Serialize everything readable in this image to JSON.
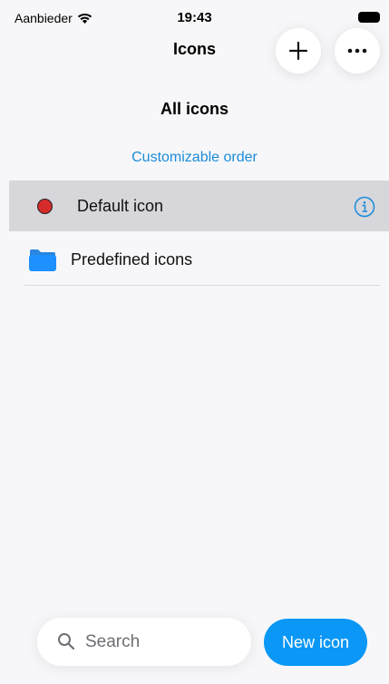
{
  "status": {
    "carrier": "Aanbieder",
    "time": "19:43"
  },
  "nav": {
    "title": "Icons",
    "add_icon": "plus-icon",
    "more_icon": "ellipsis-icon"
  },
  "list": {
    "section_title": "All icons",
    "order_link": "Customizable order",
    "items": [
      {
        "label": "Default icon",
        "icon": "red-dot-icon",
        "selected": true,
        "accessory": "info-icon"
      },
      {
        "label": "Predefined icons",
        "icon": "folder-icon",
        "selected": false
      }
    ]
  },
  "bottom": {
    "search_label": "Search",
    "new_button": "New icon"
  },
  "colors": {
    "accent": "#0a97f5",
    "link": "#1a8bd9",
    "selected_row": "#d6d6db",
    "dot": "#d52b2b"
  }
}
